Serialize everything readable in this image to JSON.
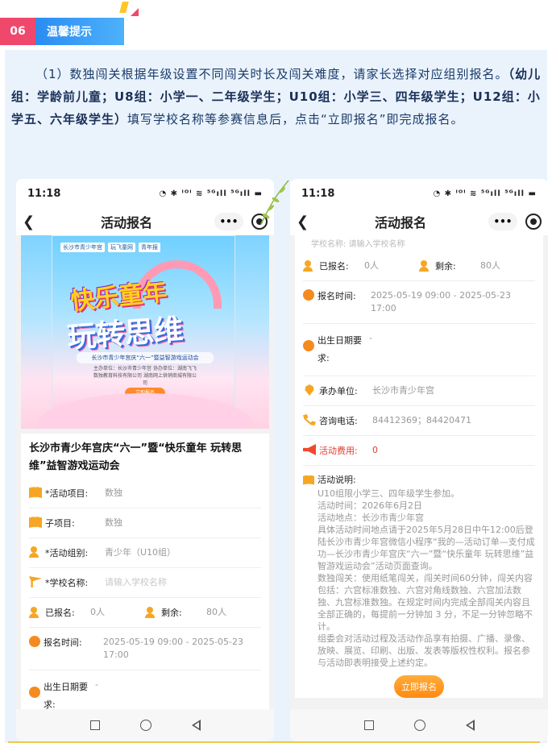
{
  "header": {
    "number": "06",
    "title": "温馨提示"
  },
  "notice": {
    "p1": "（1）数独闯关根据年级设置不同闯关时长及闯关难度，请家长选择对应组别报名。",
    "p2": "（幼儿组：学龄前儿童；U8组：小学一、二年级学生；U10组：小学三、四年级学生；U12组：小学五、六年级学生）",
    "p3": "填写学校名称等参赛信息后，点击“立即报名”即完成报名。"
  },
  "phone_left": {
    "time": "11:18",
    "status_icons": "◔ ✱ ᴵᴼᴵ ≋ ⁵ᴳıll ⁵ᴳıll ▬",
    "nav_title": "活动报名",
    "banner": {
      "logo1": "长沙市青少年宫",
      "logo2": "玩飞童网",
      "logo3": "青年报",
      "title1": "快乐童年",
      "title2": "玩转思维",
      "subtitle": "长沙市青少年宫庆“六一”暨益智游戏运动会",
      "info": "主办单位：长沙市青少年宫 协办单位：湖南飞飞数独教育科技有限公司 湖南网上供销商城有限公司",
      "button": "立即报名"
    },
    "event_title": "长沙市青少年宫庆“六一”暨“快乐童年 玩转思维”益智游戏运动会",
    "rows": [
      {
        "label": "*活动项目:",
        "value": "数独"
      },
      {
        "label": "子项目:",
        "value": "数独"
      },
      {
        "label": "*活动组别:",
        "value": "青少年（U10组）"
      },
      {
        "label": "*学校名称:",
        "placeholder": "请输入学校名称"
      }
    ],
    "enrolled_label": "已报名:",
    "enrolled_value": "0人",
    "remaining_label": "剩余:",
    "remaining_value": "80人",
    "signup_time_label": "报名时间:",
    "signup_time_value": "2025-05-19 09:00 - 2025-05-23 17:00",
    "birth_label": "出生日期要求:",
    "birth_value": "-"
  },
  "phone_right": {
    "time": "11:18",
    "status_icons": "◔ ✱ ᴵᴼᴵ ≋ ⁵ᴳıll ⁵ᴳıll ▬",
    "nav_title": "活动报名",
    "top_partial": "学校名称:    请输入学校名称",
    "enrolled_label": "已报名:",
    "enrolled_value": "0人",
    "remaining_label": "剩余:",
    "remaining_value": "80人",
    "signup_time_label": "报名时间:",
    "signup_time_value": "2025-05-19 09:00 - 2025-05-23 17:00",
    "birth_label": "出生日期要求:",
    "birth_value": "-",
    "organizer_label": "承办单位:",
    "organizer_value": "长沙市青少年宫",
    "phone_label": "咨询电话:",
    "phone_value": "84412369；84420471",
    "fee_label": "活动费用:",
    "fee_value": "0",
    "desc_label": "活动说明:",
    "desc_lines": [
      "U10组限小学三、四年级学生参加。",
      "活动时间：2026年6月2日",
      "活动地点：长沙市青少年宫",
      "具体活动时间地点请于2025年5月28日中午12:00后登陆长沙市青少年宫微信小程序“我的—活动订单—支付成功—长沙市青少年宫庆“六一”暨“快乐童年 玩转思维”益智游戏运动会”活动页面查询。",
      "数独闯关：使用纸笔闯关，闯关时间60分钟，闯关内容包括：六宫标准数独、六宫对角线数独、六宫加法数独、九宫标准数独。在规定时间内完成全部闯关内容且全部正确的，每提前一分钟加 3 分，不足一分钟忽略不计。",
      "组委会对活动过程及活动作品享有拍摄、广播、录像、放映、展览、印刷、出版、发表等版权性权利。报名参与活动即表明接受上述约定。"
    ],
    "signup_button": "立即报名"
  }
}
